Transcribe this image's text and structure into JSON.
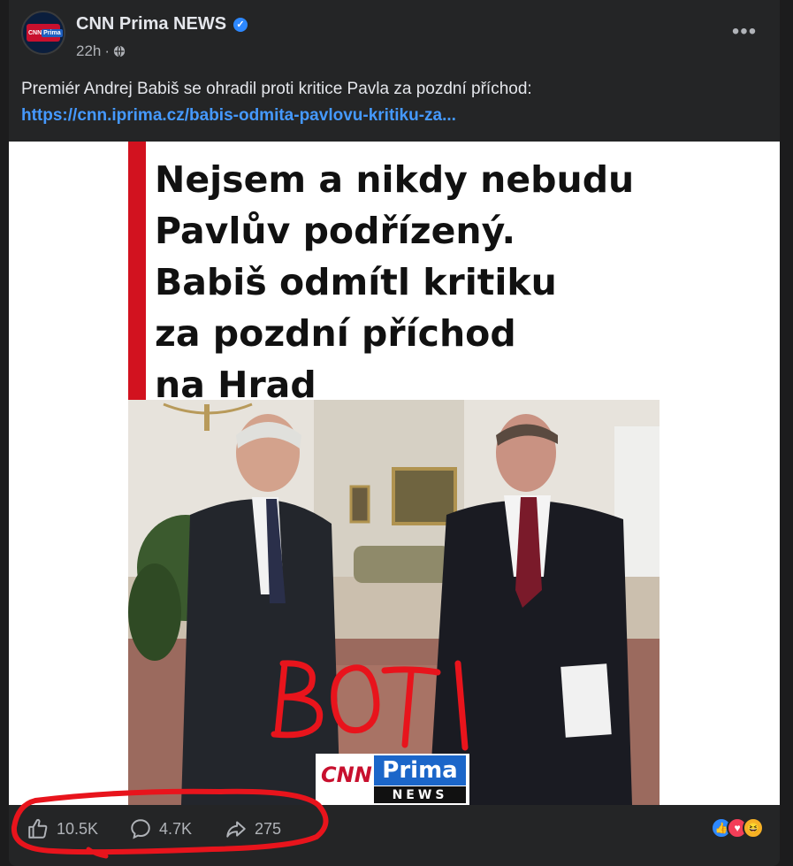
{
  "post": {
    "page_name": "CNN Prima NEWS",
    "verified_icon": "verified-badge-icon",
    "time": "22h",
    "separator": "·",
    "audience_icon": "globe-icon",
    "more_icon": "more-options-icon",
    "text": "Premiér Andrej Babiš se ohradil proti kritice Pavla za pozdní příchod:",
    "link": "https://cnn.iprima.cz/babis-odmita-pavlovu-kritiku-za..."
  },
  "avatar": {
    "logo_cnn": "CNN",
    "logo_prima": "Prima"
  },
  "image": {
    "headline_lines": [
      "Nejsem a nikdy nebudu",
      "Pavlův podřízený.",
      "Babiš odmítl kritiku",
      "za pozdní příchod",
      "na Hrad"
    ],
    "annotation": "BOTI",
    "logo_cnn": "CNN",
    "logo_prima": "Prima",
    "logo_news": "NEWS",
    "accent_color": "#d2121f"
  },
  "stats": {
    "likes": "10.5K",
    "comments": "4.7K",
    "shares": "275",
    "reactions": [
      "like-reaction-icon",
      "love-reaction-icon",
      "haha-reaction-icon"
    ]
  },
  "colors": {
    "background": "#1c1c1d",
    "card": "#242526",
    "link": "#4599ff",
    "annotation": "#e8141c"
  }
}
